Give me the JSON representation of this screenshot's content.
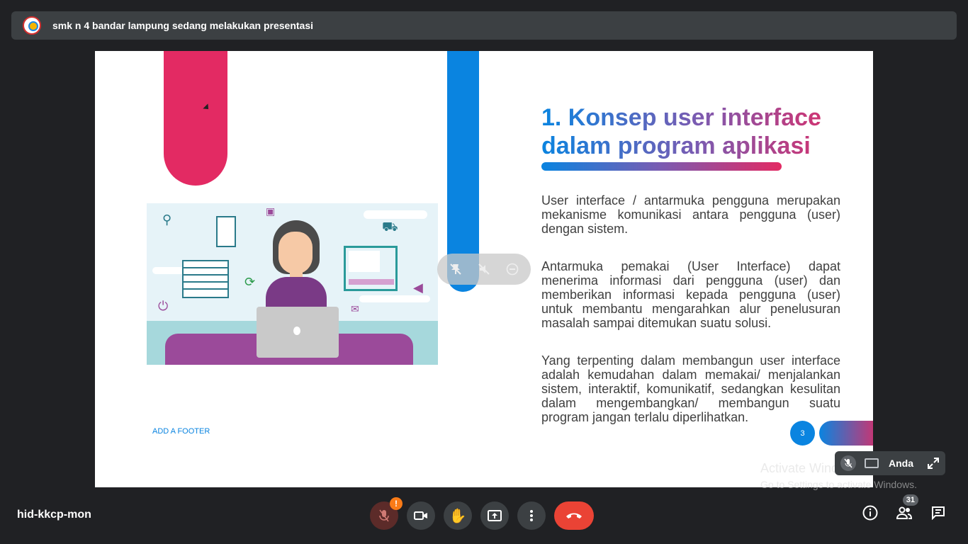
{
  "window": {
    "presenter_banner": "smk n 4 bandar lampung sedang melakukan presentasi"
  },
  "slide": {
    "heading_line1": "1. Konsep user interface",
    "heading_line2": "dalam program aplikasi",
    "paragraph1": "User interface / antarmuka pengguna merupakan mekanisme komunikasi antara pengguna (user) dengan sistem.",
    "paragraph2": "Antarmuka pemakai (User Interface) dapat menerima informasi dari pengguna (user) dan memberikan informasi kepada pengguna (user) untuk membantu mengarahkan alur penelusuran masalah sampai ditemukan suatu solusi.",
    "paragraph3": "Yang terpenting dalam  membangun user interface adalah kemudahan dalam memakai/ menjalankan sistem, interaktif, komunikatif, sedangkan kesulitan dalam mengembangkan/ membangun suatu program jangan terlalu diperlihatkan.",
    "footer": "ADD A FOOTER",
    "page_number": "3"
  },
  "watermark": {
    "line1": "Activate Windows",
    "line2": "Go to Settings to activate Windows."
  },
  "self_tile": {
    "name": "Anda"
  },
  "bottom_bar": {
    "meeting_code": "hid-kkcp-mon",
    "mic_warning_badge": "!",
    "participants_count": "31"
  },
  "colors": {
    "accent_blue": "#0a84e0",
    "accent_pink": "#e32a63",
    "end_call": "#ea4335"
  }
}
